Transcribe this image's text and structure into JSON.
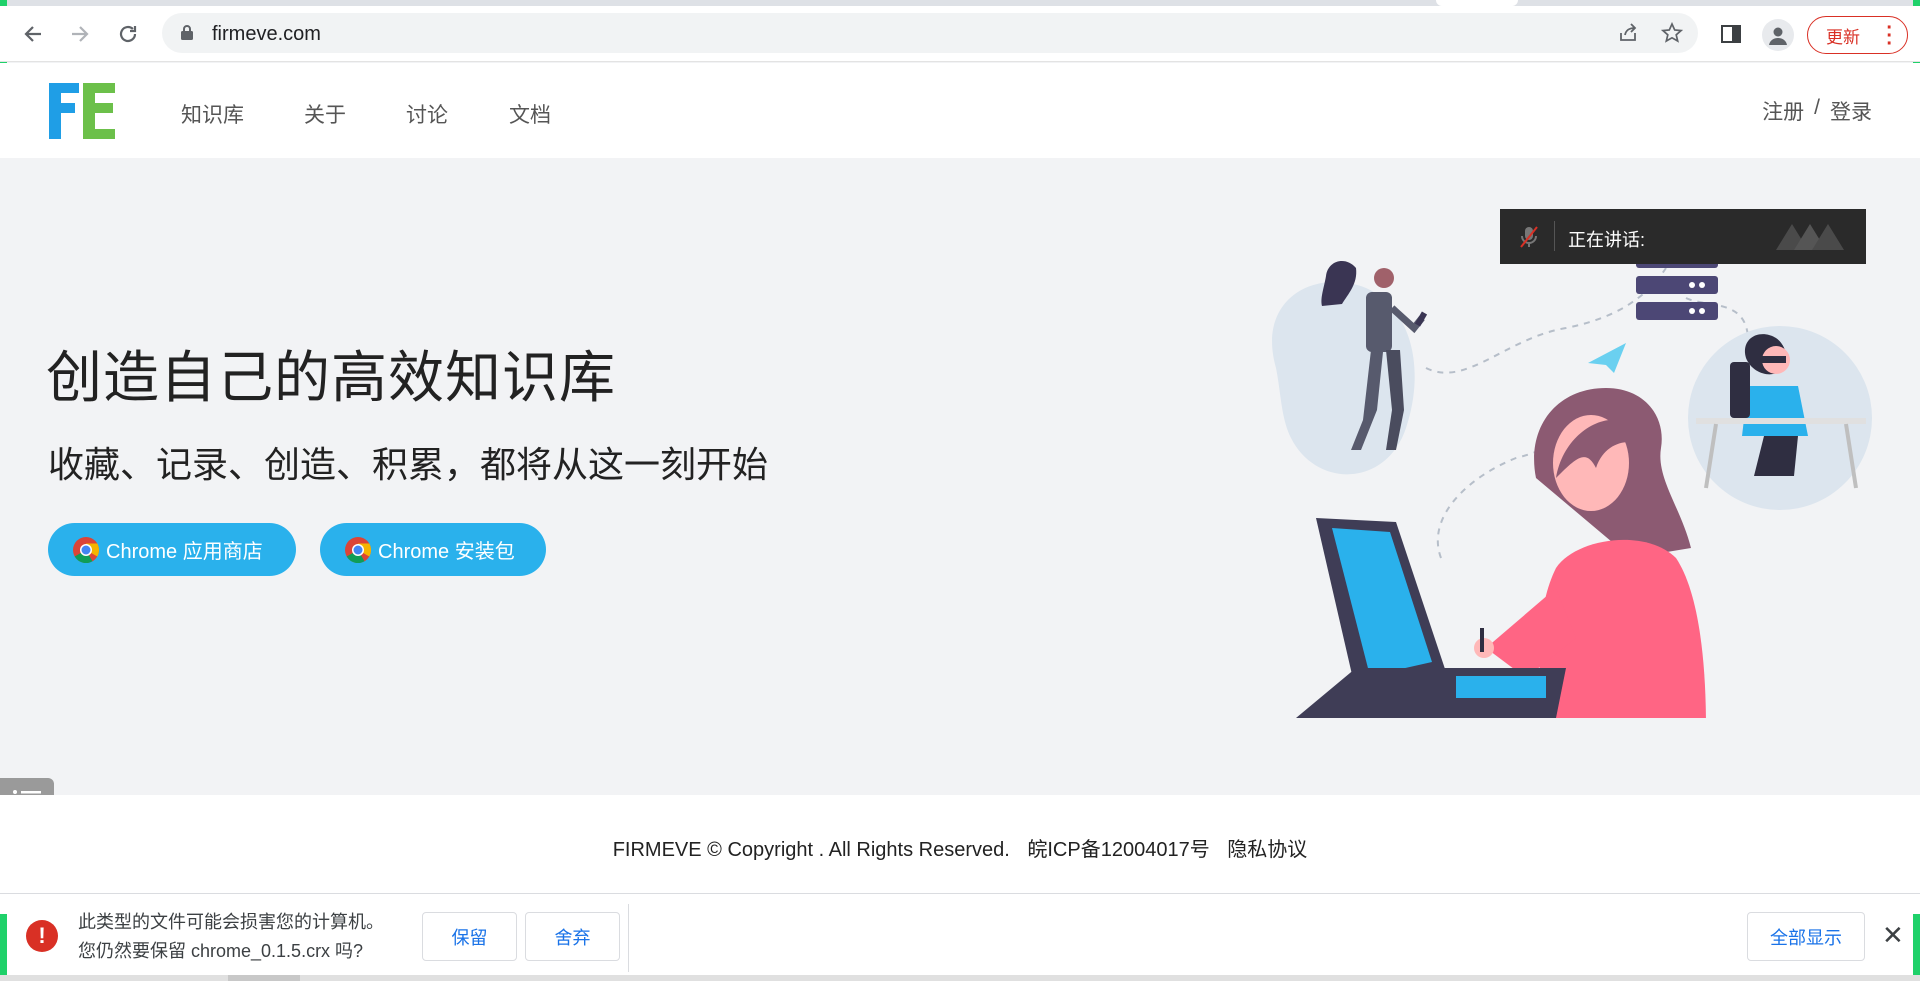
{
  "browser": {
    "url": "firmeve.com",
    "update_label": "更新"
  },
  "site": {
    "logo_text": "FE",
    "nav": [
      {
        "label": "知识库"
      },
      {
        "label": "关于"
      },
      {
        "label": "讨论"
      },
      {
        "label": "文档"
      }
    ],
    "auth": {
      "register": "注册",
      "separator": "/",
      "login": "登录"
    }
  },
  "hero": {
    "title": "创造自己的高效知识库",
    "subtitle": "收藏、记录、创造、积累，都将从这一刻开始",
    "buttons": [
      {
        "label": "Chrome 应用商店"
      },
      {
        "label": "Chrome 安装包"
      }
    ]
  },
  "speaking_overlay": {
    "label": "正在讲话:"
  },
  "footer": {
    "copyright": "FIRMEVE © Copyright . All Rights Reserved.",
    "icp": "皖ICP备12004017号",
    "privacy": "隐私协议"
  },
  "download_bar": {
    "message_line1": "此类型的文件可能会损害您的计算机。",
    "message_line2": "您仍然要保留 chrome_0.1.5.crx 吗?",
    "keep": "保留",
    "discard": "舍弃",
    "show_all": "全部显示"
  },
  "colors": {
    "accent": "#2ab1ec",
    "logo_blue": "#1f9ee6",
    "logo_green": "#6cc04a",
    "warning": "#d93025"
  }
}
